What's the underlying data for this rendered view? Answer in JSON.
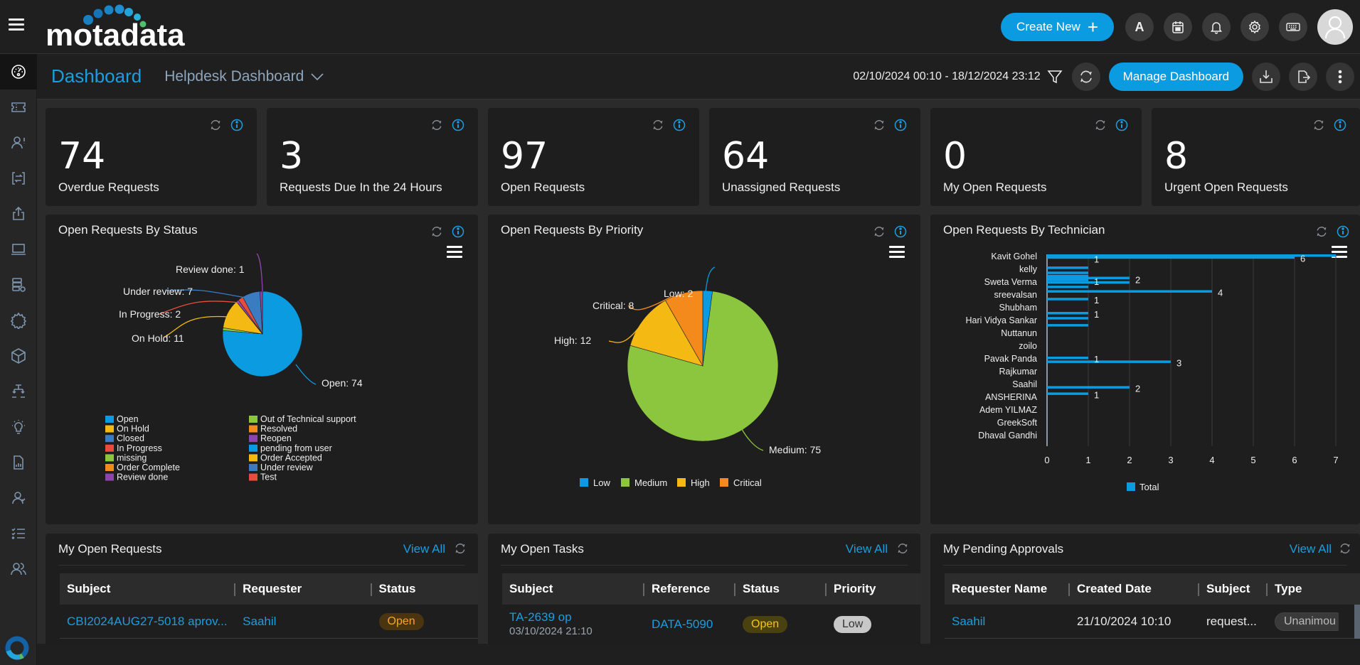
{
  "header": {
    "logo_text": "motadata",
    "create_new_label": "Create New",
    "avatar_letter": "A",
    "icons": [
      "hamburger-icon",
      "calendar-icon",
      "bell-icon",
      "gear-icon",
      "keyboard-icon",
      "user-avatar-icon"
    ]
  },
  "sidebar": {
    "items": [
      {
        "name": "dashboard",
        "icon": "speedometer-icon",
        "active": true
      },
      {
        "name": "requests",
        "icon": "ticket-icon"
      },
      {
        "name": "problems",
        "icon": "user-alert-icon"
      },
      {
        "name": "changes",
        "icon": "change-arrows-icon"
      },
      {
        "name": "releases",
        "icon": "upload-icon"
      },
      {
        "name": "assets",
        "icon": "laptop-icon"
      },
      {
        "name": "cmdb",
        "icon": "server-gear-icon"
      },
      {
        "name": "patch",
        "icon": "virus-icon"
      },
      {
        "name": "software",
        "icon": "cube-icon"
      },
      {
        "name": "projects",
        "icon": "hierarchy-icon"
      },
      {
        "name": "knowledge",
        "icon": "lightbulb-icon"
      },
      {
        "name": "reports",
        "icon": "report-icon"
      },
      {
        "name": "approvals",
        "icon": "user-check-icon"
      },
      {
        "name": "tasks",
        "icon": "checklist-icon"
      },
      {
        "name": "users",
        "icon": "users-icon"
      }
    ]
  },
  "subbar": {
    "title": "Dashboard",
    "dashboard_select": "Helpdesk Dashboard",
    "date_range": "02/10/2024 00:10 - 18/12/2024 23:12",
    "manage_label": "Manage Dashboard"
  },
  "kpis": [
    {
      "value": "74",
      "label": "Overdue Requests"
    },
    {
      "value": "3",
      "label": "Requests Due In the 24 Hours"
    },
    {
      "value": "97",
      "label": "Open Requests"
    },
    {
      "value": "64",
      "label": "Unassigned Requests"
    },
    {
      "value": "0",
      "label": "My Open Requests"
    },
    {
      "value": "8",
      "label": "Urgent Open Requests"
    }
  ],
  "chart_data": [
    {
      "type": "pie",
      "title": "Open Requests By Status",
      "slices": [
        {
          "label": "Open",
          "value": 74,
          "color": "#0a9be0"
        },
        {
          "label": "missing",
          "value": 1,
          "color": "#8cc63f"
        },
        {
          "label": "On Hold",
          "value": 11,
          "color": "#f5b914"
        },
        {
          "label": "Reopen",
          "value": 1,
          "color": "#8e44ad"
        },
        {
          "label": "In Progress",
          "value": 2,
          "color": "#e84c3d"
        },
        {
          "label": "Under review",
          "value": 7,
          "color": "#3b7bbf"
        },
        {
          "label": "Review done",
          "value": 1,
          "color": "#8e44ad"
        }
      ],
      "data_labels": [
        "Review done: 1",
        "Under review: 7",
        "In Progress: 2",
        "On Hold: 11",
        "Open: 74"
      ],
      "legend": [
        {
          "label": "Open",
          "color": "#0a9be0"
        },
        {
          "label": "On Hold",
          "color": "#f5b914"
        },
        {
          "label": "Closed",
          "color": "#3b7bbf"
        },
        {
          "label": "In Progress",
          "color": "#e84c3d"
        },
        {
          "label": "missing",
          "color": "#8cc63f"
        },
        {
          "label": "Order Complete",
          "color": "#f38a1b"
        },
        {
          "label": "Review done",
          "color": "#8e44ad"
        },
        {
          "label": "Out of Technical support",
          "color": "#8cc63f"
        },
        {
          "label": "Resolved",
          "color": "#f38a1b"
        },
        {
          "label": "Reopen",
          "color": "#8e44ad"
        },
        {
          "label": "pending from user",
          "color": "#0a9be0"
        },
        {
          "label": "Order Accepted",
          "color": "#f5b914"
        },
        {
          "label": "Under review",
          "color": "#3b7bbf"
        },
        {
          "label": "Test",
          "color": "#e84c3d"
        }
      ],
      "legend_position": "bottom"
    },
    {
      "type": "pie",
      "title": "Open Requests By Priority",
      "slices": [
        {
          "label": "Low",
          "value": 2,
          "color": "#0a9be0"
        },
        {
          "label": "Medium",
          "value": 75,
          "color": "#8cc63f"
        },
        {
          "label": "High",
          "value": 12,
          "color": "#f5b914"
        },
        {
          "label": "Critical",
          "value": 8,
          "color": "#f38a1b"
        }
      ],
      "data_labels": [
        "Low: 2",
        "Medium: 75",
        "High: 12",
        "Critical: 8"
      ],
      "legend_position": "bottom"
    },
    {
      "type": "bar",
      "orientation": "horizontal",
      "title": "Open Requests By Technician",
      "categories": [
        "Kavit Gohel",
        "kelly",
        "Sweta Verma",
        "sreevalsan",
        "Shubham",
        "Hari Vidya Sankar",
        "Nuttanun",
        "zoilo",
        "Pavak Panda",
        "Rajkumar",
        "Saahil",
        "ANSHERINA",
        "Adem YILMAZ",
        "GreekSoft",
        "Dhaval Gandhi"
      ],
      "bars": [
        {
          "pos": 0.0,
          "value": 7
        },
        {
          "pos": 0.05,
          "value": 1
        },
        {
          "pos": 0.15,
          "value": 6
        },
        {
          "pos": 0.95,
          "value": 1
        },
        {
          "pos": 1.35,
          "value": 1
        },
        {
          "pos": 1.6,
          "value": 1
        },
        {
          "pos": 1.75,
          "value": 2
        },
        {
          "pos": 1.9,
          "value": 1
        },
        {
          "pos": 2.1,
          "value": 2
        },
        {
          "pos": 2.45,
          "value": 1
        },
        {
          "pos": 2.8,
          "value": 4
        },
        {
          "pos": 3.4,
          "value": 1
        },
        {
          "pos": 4.5,
          "value": 1
        },
        {
          "pos": 4.9,
          "value": 1
        },
        {
          "pos": 5.45,
          "value": 1
        },
        {
          "pos": 8.0,
          "value": 1
        },
        {
          "pos": 8.3,
          "value": 3
        },
        {
          "pos": 10.3,
          "value": 2
        },
        {
          "pos": 10.8,
          "value": 1
        }
      ],
      "value_labels": [
        {
          "pos": 0.2,
          "text": "1",
          "value": 1
        },
        {
          "pos": 0.15,
          "text": "6",
          "value": 6
        },
        {
          "pos": 1.8,
          "text": "2",
          "value": 2
        },
        {
          "pos": 1.95,
          "text": "1",
          "value": 1
        },
        {
          "pos": 2.8,
          "text": "4",
          "value": 4
        },
        {
          "pos": 3.4,
          "text": "1",
          "value": 1
        },
        {
          "pos": 4.5,
          "text": "1",
          "value": 1
        },
        {
          "pos": 8.0,
          "text": "1",
          "value": 1
        },
        {
          "pos": 8.3,
          "text": "3",
          "value": 3
        },
        {
          "pos": 10.3,
          "text": "2",
          "value": 2
        },
        {
          "pos": 10.8,
          "text": "1",
          "value": 1
        }
      ],
      "x_ticks": [
        "0",
        "1",
        "2",
        "3",
        "4",
        "5",
        "6",
        "7"
      ],
      "xlim": [
        0,
        7
      ],
      "series_name": "Total",
      "series_color": "#0a9be0",
      "grid": true,
      "legend_position": "bottom"
    }
  ],
  "widgets": {
    "my_open_requests": {
      "title": "My Open Requests",
      "view_all": "View All",
      "columns": [
        "Subject",
        "Requester",
        "Status"
      ],
      "rows": [
        {
          "subject": "CBI2024AUG27-5018 aprov...",
          "requester": "Saahil",
          "status": "Open"
        }
      ]
    },
    "my_open_tasks": {
      "title": "My Open Tasks",
      "view_all": "View All",
      "columns": [
        "Subject",
        "Reference",
        "Status",
        "Priority"
      ],
      "rows": [
        {
          "subject": "TA-2639 op",
          "date": "03/10/2024 21:10",
          "reference": "DATA-5090",
          "status": "Open",
          "priority": "Low"
        }
      ]
    },
    "my_pending_approvals": {
      "title": "My Pending Approvals",
      "view_all": "View All",
      "columns": [
        "Requester Name",
        "Created Date",
        "Subject",
        "Type"
      ],
      "rows": [
        {
          "requester": "Saahil",
          "created": "21/10/2024 10:10",
          "subject": "request...",
          "type": "Unanimou"
        }
      ]
    }
  },
  "colors": {
    "accent": "#0a9be0",
    "card_bg": "#1e1e1e",
    "page_bg": "#2b2b2b"
  }
}
